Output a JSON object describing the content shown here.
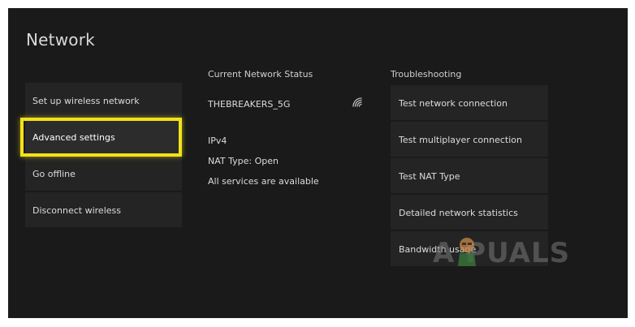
{
  "header": {
    "title": "Network"
  },
  "left_menu": {
    "items": [
      {
        "label": "Set up wireless network"
      },
      {
        "label": "Advanced settings"
      },
      {
        "label": "Go offline"
      },
      {
        "label": "Disconnect wireless"
      }
    ],
    "selected_index": 1
  },
  "status": {
    "heading": "Current Network Status",
    "network_name": "THEBREAKERS_5G",
    "network_icon": "wifi-signal-icon",
    "lines": [
      "IPv4",
      "NAT Type: Open",
      "All services are available"
    ]
  },
  "troubleshooting": {
    "heading": "Troubleshooting",
    "items": [
      {
        "label": "Test network connection"
      },
      {
        "label": "Test multiplayer connection"
      },
      {
        "label": "Test NAT Type"
      },
      {
        "label": "Detailed network statistics"
      },
      {
        "label": "Bandwidth usage"
      }
    ]
  },
  "highlight": {
    "color": "#f2e21b"
  },
  "watermark": {
    "text": "A  PUALS"
  }
}
